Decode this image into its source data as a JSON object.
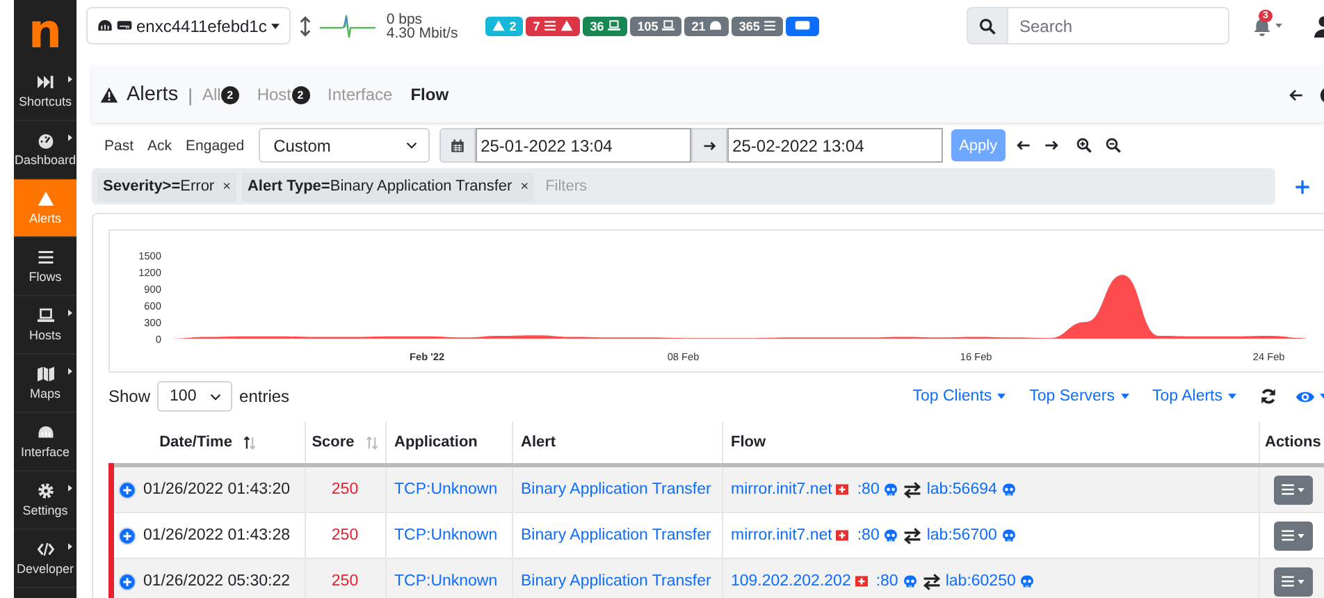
{
  "sidebar": {
    "logo": "n",
    "items": [
      {
        "label": "Shortcuts",
        "has_submenu": true,
        "selected": false
      },
      {
        "label": "Dashboard",
        "has_submenu": true,
        "selected": false
      },
      {
        "label": "Alerts",
        "has_submenu": false,
        "selected": true
      },
      {
        "label": "Flows",
        "has_submenu": false,
        "selected": false
      },
      {
        "label": "Hosts",
        "has_submenu": true,
        "selected": false
      },
      {
        "label": "Maps",
        "has_submenu": true,
        "selected": false
      },
      {
        "label": "Interface",
        "has_submenu": false,
        "selected": false
      },
      {
        "label": "Settings",
        "has_submenu": true,
        "selected": false
      },
      {
        "label": "Developer",
        "has_submenu": true,
        "selected": false
      }
    ]
  },
  "topbar": {
    "interface": {
      "name": "enxc4411efebd1c"
    },
    "traffic": {
      "upload": "0 bps",
      "download": "4.30 Mbit/s"
    },
    "badges": [
      {
        "kind": "alerts",
        "count": "2",
        "color": "#17b7da"
      },
      {
        "kind": "flow-alerts",
        "count": "7",
        "color": "#dc3545"
      },
      {
        "kind": "local-hosts",
        "count": "36",
        "color": "#198754"
      },
      {
        "kind": "hosts",
        "count": "105",
        "color": "#6c757d"
      },
      {
        "kind": "devices",
        "count": "21",
        "color": "#6c757d"
      },
      {
        "kind": "flows",
        "count": "365",
        "color": "#6c757d"
      },
      {
        "kind": "interface",
        "color": "#0d6efd"
      }
    ],
    "search": {
      "placeholder": "Search"
    },
    "notifications": {
      "count": "3"
    }
  },
  "page_header": {
    "title": "Alerts",
    "separator": "|",
    "tabs": [
      {
        "label": "All",
        "count": "2",
        "selected": false
      },
      {
        "label": "Host",
        "count": "2",
        "selected": false
      },
      {
        "label": "Interface",
        "selected": false
      },
      {
        "label": "Flow",
        "selected": true
      }
    ]
  },
  "time_toolbar": {
    "links": [
      {
        "label": "Past"
      },
      {
        "label": "Ack"
      },
      {
        "label": "Engaged"
      }
    ],
    "range": {
      "value": "Custom"
    },
    "start": "25-01-2022 13:04",
    "end": "25-02-2022 13:04",
    "apply": {
      "label": "Apply",
      "disabled": true
    }
  },
  "filter_bar": {
    "chips": [
      {
        "text": "**Severity>=**Error",
        "remove": "×"
      },
      {
        "text": "**Alert Type=**Binary Application Transfer",
        "remove": "×"
      }
    ],
    "placeholder": "Filters"
  },
  "chart": {
    "chart_data": {
      "type": "area",
      "categories": [
        null,
        null,
        null,
        null,
        null,
        null,
        null,
        "Feb '22",
        null,
        null,
        null,
        null,
        null,
        null,
        "08 Feb",
        null,
        null,
        null,
        null,
        null,
        null,
        null,
        "16 Feb",
        null,
        null,
        null,
        null,
        null,
        null,
        null,
        "24 Feb",
        null
      ],
      "series": [
        {
          "color": "#ff4d4f",
          "values": [
            0,
            30,
            40,
            40,
            30,
            30,
            40,
            40,
            20,
            50,
            60,
            30,
            20,
            20,
            10,
            10,
            10,
            20,
            20,
            20,
            30,
            20,
            30,
            20,
            10,
            300,
            1150,
            50,
            40,
            40,
            50,
            10
          ]
        }
      ],
      "ylim": [
        0,
        1500
      ],
      "yticks": [
        0,
        300,
        600,
        900,
        1200,
        1500
      ]
    }
  },
  "table": {
    "page_length": {
      "before": "Show",
      "value": "100",
      "after": "entries"
    },
    "menus": [
      {
        "label": "Top Clients"
      },
      {
        "label": "Top Servers"
      },
      {
        "label": "Top Alerts"
      }
    ],
    "columns": [
      {
        "label": "Date/Time",
        "sorted": true
      },
      {
        "label": "Score",
        "sorted": false
      },
      {
        "label": "Application"
      },
      {
        "label": "Alert"
      },
      {
        "label": "Flow"
      },
      {
        "label": "Actions"
      }
    ],
    "rows": [
      {
        "datetime": "01/26/2022 01:43:20",
        "score": "250",
        "application": "TCP:Unknown",
        "alert": "Binary Application Transfer",
        "flow": {
          "server": "mirror.init7.net",
          "server_port": ":80",
          "client": "lab:56694"
        }
      },
      {
        "datetime": "01/26/2022 01:43:28",
        "score": "250",
        "application": "TCP:Unknown",
        "alert": "Binary Application Transfer",
        "flow": {
          "server": "mirror.init7.net",
          "server_port": ":80",
          "client": "lab:56700"
        }
      },
      {
        "datetime": "01/26/2022 05:30:22",
        "score": "250",
        "application": "TCP:Unknown",
        "alert": "Binary Application Transfer",
        "flow": {
          "server": "109.202.202.202",
          "server_port": ":80",
          "client": "lab:60250"
        }
      }
    ]
  }
}
